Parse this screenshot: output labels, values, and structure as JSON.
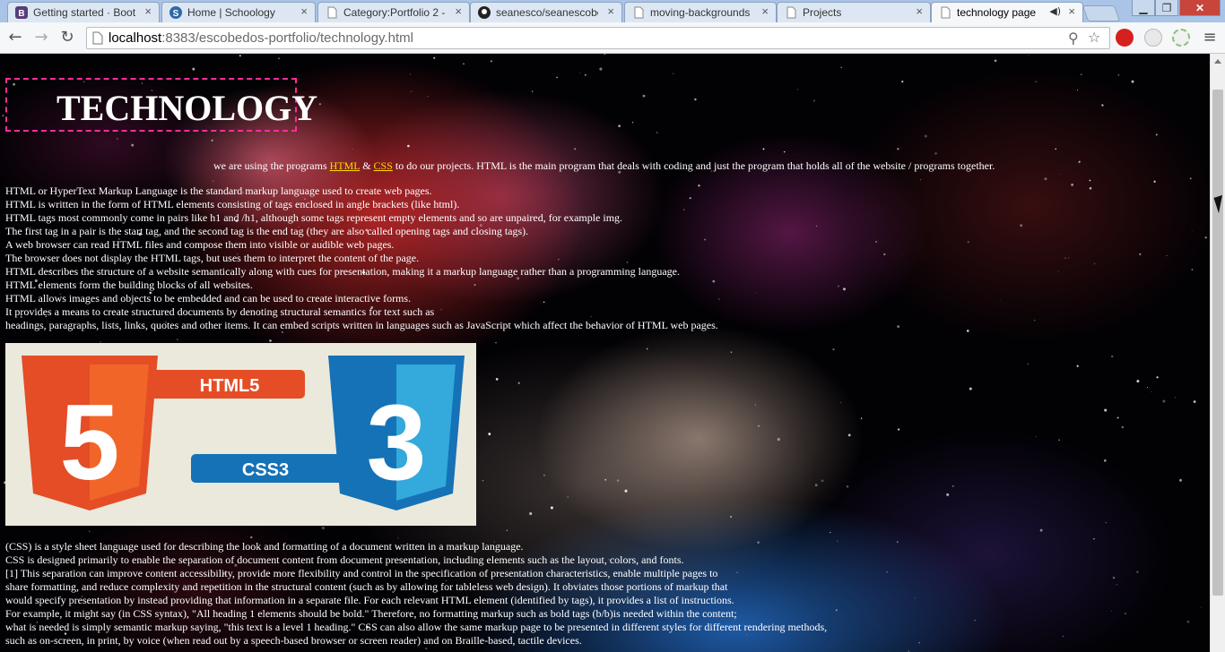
{
  "browser": {
    "tabs": [
      {
        "label": "Getting started · Boots",
        "icon": "bootstrap-icon",
        "icon_color": "#563d7c"
      },
      {
        "label": "Home | Schoology",
        "icon": "schoology-icon",
        "icon_color": "#2b6aa8"
      },
      {
        "label": "Category:Portfolio 2 -",
        "icon": "page-icon",
        "icon_color": "#888888"
      },
      {
        "label": "seanesco/seanescobe",
        "icon": "github-icon",
        "icon_color": "#222222"
      },
      {
        "label": "moving-backgrounds",
        "icon": "page-icon",
        "icon_color": "#888888"
      },
      {
        "label": "Projects",
        "icon": "page-icon",
        "icon_color": "#888888"
      },
      {
        "label": "technology page",
        "icon": "page-icon",
        "icon_color": "#888888",
        "active": true,
        "audio": "speaker-icon"
      }
    ],
    "url_host": "localhost",
    "url_rest": ":8383/escobedos-portfolio/technology.html",
    "window_controls": [
      "minimize",
      "maximize",
      "close"
    ]
  },
  "page": {
    "title": "TECHNOLOGY",
    "intro": {
      "before": "we are using the programs ",
      "link1": "HTML",
      "middle": " & ",
      "link2": "CSS",
      "after": " to do our projects. HTML is the main program that deals with coding and just the program that holds all of the website / programs together."
    },
    "html_paragraph": [
      "HTML or HyperText Markup Language is the standard markup language used to create web pages.",
      "HTML is written in the form of HTML elements consisting of tags enclosed in angle brackets (like html).",
      "HTML tags most commonly come in pairs like h1 and /h1, although some tags represent empty elements and so are unpaired, for example img.",
      "The first tag in a pair is the start tag, and the second tag is the end tag (they are also called opening tags and closing tags).",
      "A web browser can read HTML files and compose them into visible or audible web pages.",
      "The browser does not display the HTML tags, but uses them to interpret the content of the page.",
      "HTML describes the structure of a website semantically along with cues for presentation, making it a markup language rather than a programming language.",
      "HTML elements form the building blocks of all websites.",
      "HTML allows images and objects to be embedded and can be used to create interactive forms.",
      "It provides a means to create structured documents by denoting structural semantics for text such as",
      "headings, paragraphs, lists, links, quotes and other items. It can embed scripts written in languages such as JavaScript which affect the behavior of HTML web pages."
    ],
    "logo_image": {
      "html5_label": "HTML5",
      "css3_label": "CSS3",
      "html5_digit": "5",
      "css3_digit": "3",
      "html5_color": "#e44d26",
      "css3_color": "#1572b6"
    },
    "css_paragraph": [
      "(CSS) is a style sheet language used for describing the look and formatting of a document written in a markup language.",
      "CSS is designed primarily to enable the separation of document content from document presentation, including elements such as the layout, colors, and fonts.",
      "[1] This separation can improve content accessibility, provide more flexibility and control in the specification of presentation characteristics, enable multiple pages to",
      "share formatting, and reduce complexity and repetition in the structural content (such as by allowing for tableless web design). It obviates those portions of markup that",
      "would specify presentation by instead providing that information in a separate file. For each relevant HTML element (identified by tags), it provides a list of instructions.",
      "For example, it might say (in CSS syntax), \"All heading 1 elements should be bold.\" Therefore, no formatting markup such as bold tags (b/b)is needed within the content;",
      "what is needed is simply semantic markup saying, \"this text is a level 1 heading.\" CSS can also allow the same markup page to be presented in different styles for different rendering methods,",
      "such as on-screen, in print, by voice (when read out by a speech-based browser or screen reader) and on Braille-based, tactile devices."
    ],
    "colors": {
      "title_border": "#ff2d9a",
      "link": "#ffd700",
      "text": "#ffffff"
    }
  }
}
